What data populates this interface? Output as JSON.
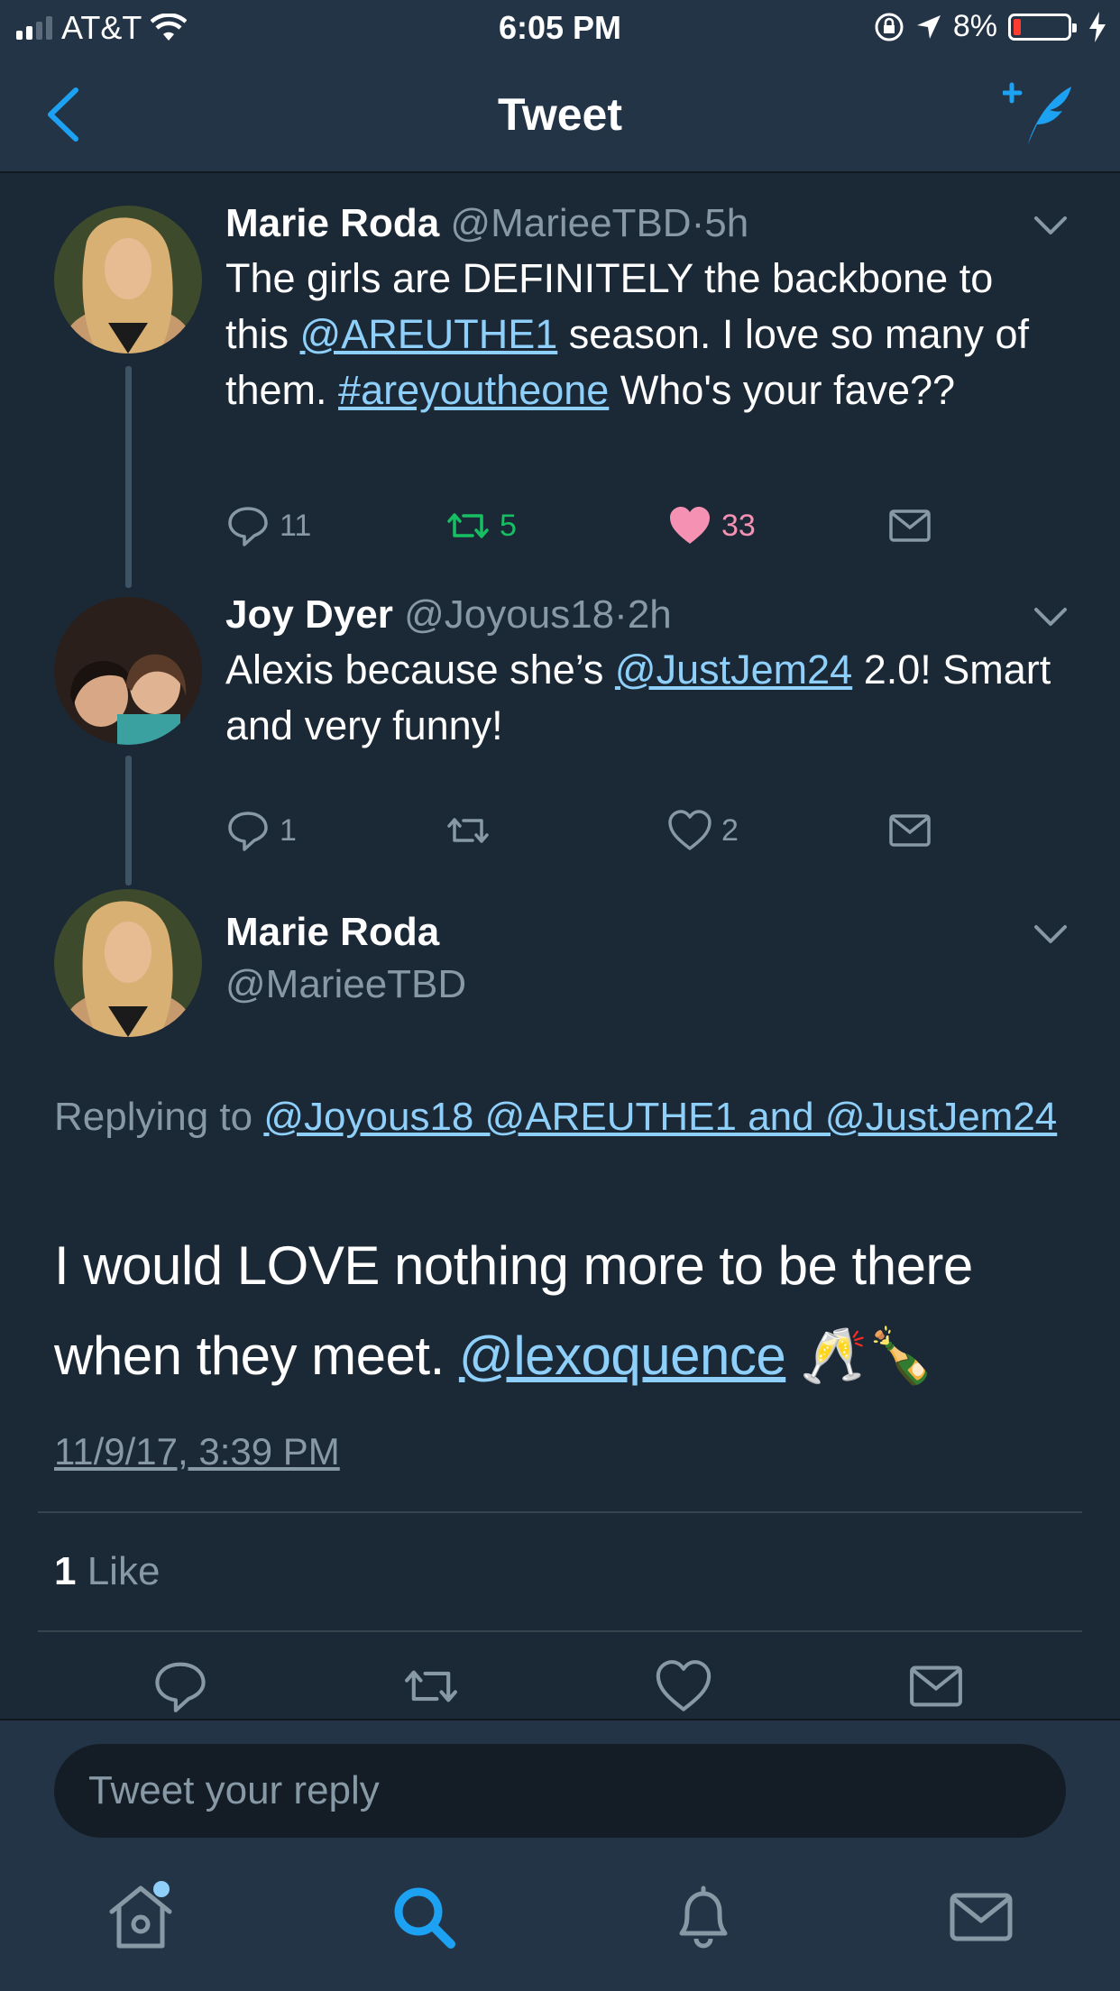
{
  "status_bar": {
    "carrier": "AT&T",
    "time": "6:05 PM",
    "battery": "8%"
  },
  "nav": {
    "title": "Tweet"
  },
  "tweets": [
    {
      "name": "Marie Roda",
      "handle": "@MarieeTBD",
      "separator": "·",
      "age": "5h",
      "text_parts": [
        "The girls are DEFINITELY the backbone to this ",
        "@AREUTHE1",
        " season. I love so many of them. ",
        "#areyoutheone",
        " Who's your fave??"
      ],
      "replies": "11",
      "retweets": "5",
      "likes": "33"
    },
    {
      "name": "Joy Dyer",
      "handle": "@Joyous18",
      "separator": "·",
      "age": "2h",
      "text_parts": [
        "Alexis because she’s ",
        "@JustJem24",
        " 2.0! Smart and very funny!"
      ],
      "replies": "1",
      "retweets": "",
      "likes": "2"
    }
  ],
  "focused": {
    "name": "Marie Roda",
    "handle": "@MarieeTBD",
    "replying_prefix": "Replying to ",
    "replying_to": "@Joyous18 @AREUTHE1 and @JustJem24",
    "text_before": "I would LOVE nothing more to be there when they meet. ",
    "mention": "@lexoquence",
    "emoji": "🥂🍾",
    "timestamp": "11/9/17, 3:39 PM",
    "like_count": "1",
    "like_label": " Like"
  },
  "reply": {
    "placeholder": "Tweet your reply"
  },
  "colors": {
    "background": "#1b2836",
    "bar": "#243447",
    "accent": "#1da1f2",
    "link": "#8fd0fb",
    "retweet_active": "#17bf63",
    "like_active": "#f591b2",
    "secondary_text": "#8899a6"
  }
}
